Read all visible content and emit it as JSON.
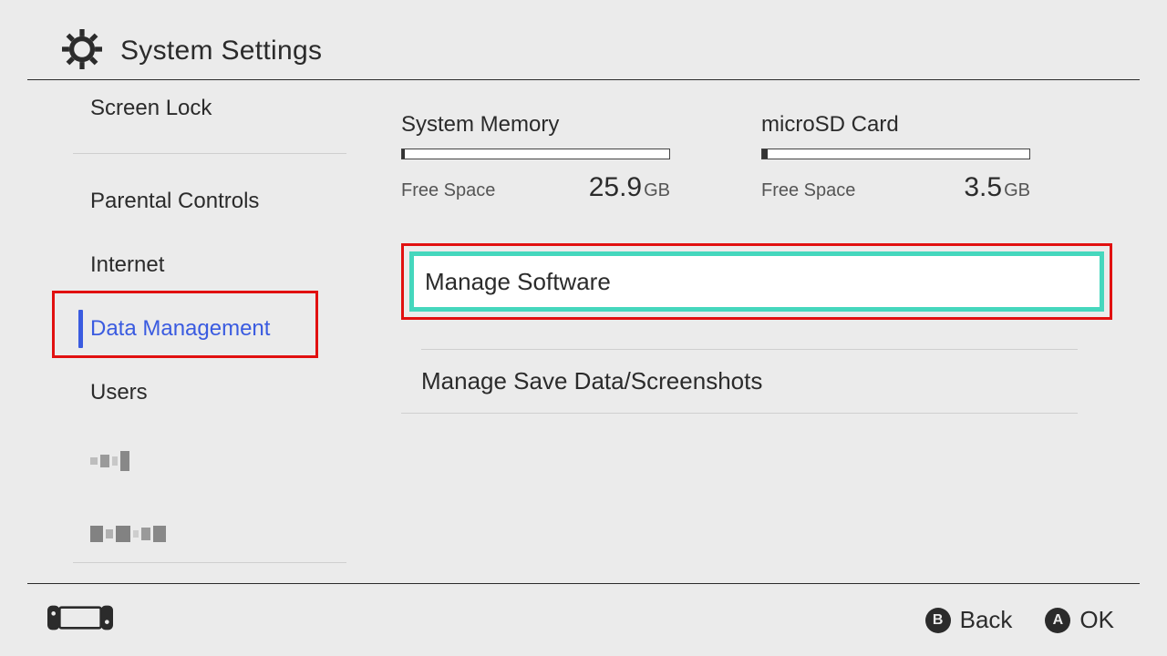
{
  "header": {
    "title": "System Settings"
  },
  "sidebar": {
    "items": [
      {
        "label": "Screen Lock"
      },
      {
        "label": "Parental Controls"
      },
      {
        "label": "Internet"
      },
      {
        "label": "Data Management",
        "selected": true
      },
      {
        "label": "Users"
      }
    ]
  },
  "storage": {
    "system": {
      "title": "System Memory",
      "free_label": "Free Space",
      "amount": "25.9",
      "unit": "GB",
      "used_pct": 1
    },
    "sd": {
      "title": "microSD Card",
      "free_label": "Free Space",
      "amount": "3.5",
      "unit": "GB",
      "used_pct": 2
    }
  },
  "options": {
    "manage_software": "Manage Software",
    "manage_save": "Manage Save Data/Screenshots"
  },
  "footer": {
    "b_glyph": "B",
    "b_label": "Back",
    "a_glyph": "A",
    "a_label": "OK"
  },
  "colors": {
    "highlight_red": "#e11010",
    "highlight_teal": "#45d7bd",
    "selected_blue": "#3a5be0"
  }
}
